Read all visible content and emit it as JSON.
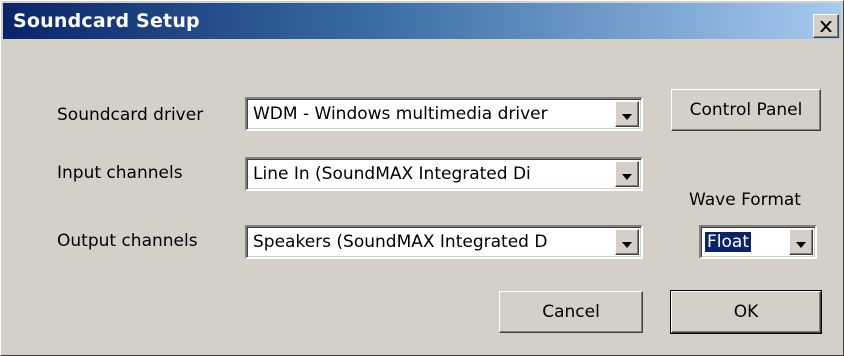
{
  "window": {
    "title": "Soundcard Setup",
    "close_glyph": "X"
  },
  "labels": {
    "soundcard_driver": "Soundcard driver",
    "input_channels": "Input channels",
    "output_channels": "Output channels",
    "wave_format": "Wave Format"
  },
  "combos": {
    "driver": "WDM - Windows multimedia driver",
    "input": "Line In (SoundMAX Integrated Di",
    "output": "Speakers (SoundMAX Integrated D",
    "wave_format": "Float"
  },
  "buttons": {
    "control_panel": "Control Panel",
    "cancel": "Cancel",
    "ok": "OK"
  },
  "icons": {
    "close": "close-icon",
    "dropdown": "dropdown-arrow-icon"
  },
  "colors": {
    "titlebar_start": "#0a246a",
    "titlebar_end": "#a6caf0",
    "face": "#d4d0c8",
    "selection": "#0a246a"
  }
}
